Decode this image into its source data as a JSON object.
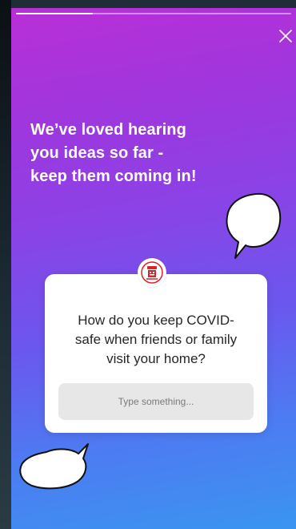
{
  "story": {
    "progress": 0.28,
    "headline": [
      "We’ve loved hearing",
      "you ideas so far -",
      "keep them coming in!"
    ]
  },
  "question_sticker": {
    "question_lines": [
      "How do you keep COVID-",
      "safe when friends or family",
      "visit your home?"
    ],
    "answer_placeholder": "Type something..."
  },
  "icons": {
    "close": "close-icon",
    "avatar": "profile-avatar-icon",
    "bubbles": "speech-bubble-icon"
  },
  "colors": {
    "gradient_top": "#b92fd6",
    "gradient_bottom": "#3a95f0",
    "avatar_accent": "#d8232a"
  }
}
